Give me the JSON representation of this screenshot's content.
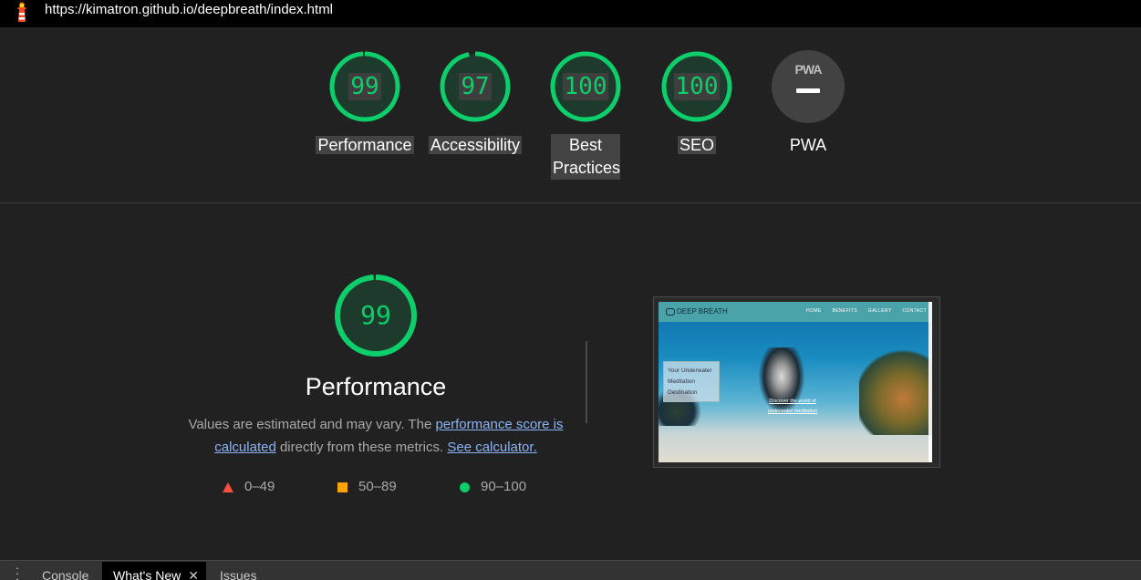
{
  "browser": {
    "url": "https://kimatron.github.io/deepbreath/index.html",
    "logo_icon": "lighthouse-icon"
  },
  "gauges": [
    {
      "label": "Performance",
      "score": "99",
      "percent": 0.99
    },
    {
      "label": "Accessibility",
      "score": "97",
      "percent": 0.97
    },
    {
      "label": "Best Practices",
      "score": "100",
      "percent": 1.0
    },
    {
      "label": "SEO",
      "score": "100",
      "percent": 1.0
    },
    {
      "label": "PWA",
      "badge": "PWA",
      "icon": "pwa-dash-icon"
    }
  ],
  "performance": {
    "score": "99",
    "title": "Performance",
    "desc_prefix": "Values are estimated and may vary. The ",
    "desc_link1": "performance score is calculated",
    "desc_middle": " directly from these metrics. ",
    "desc_link2": "See calculator."
  },
  "legend": [
    {
      "range": "0–49",
      "color": "#ff4e42",
      "shape": "triangle"
    },
    {
      "range": "50–89",
      "color": "#ffa400",
      "shape": "square"
    },
    {
      "range": "90–100",
      "color": "#0cce6b",
      "shape": "circle"
    }
  ],
  "thumbnail": {
    "brand": "DEEP BREATH",
    "nav": [
      "HOME",
      "BENEFITS",
      "GALLERY",
      "CONTACT"
    ],
    "card_text": "Your Underwater Meditation Destination",
    "cta_text": "Discover the world of underwater meditation"
  },
  "drawer": {
    "tabs": [
      {
        "label": "Console",
        "active": false
      },
      {
        "label": "What's New",
        "active": true
      },
      {
        "label": "Issues",
        "active": false
      }
    ]
  },
  "colors": {
    "pass": "#0cce6b",
    "background": "#212121"
  }
}
